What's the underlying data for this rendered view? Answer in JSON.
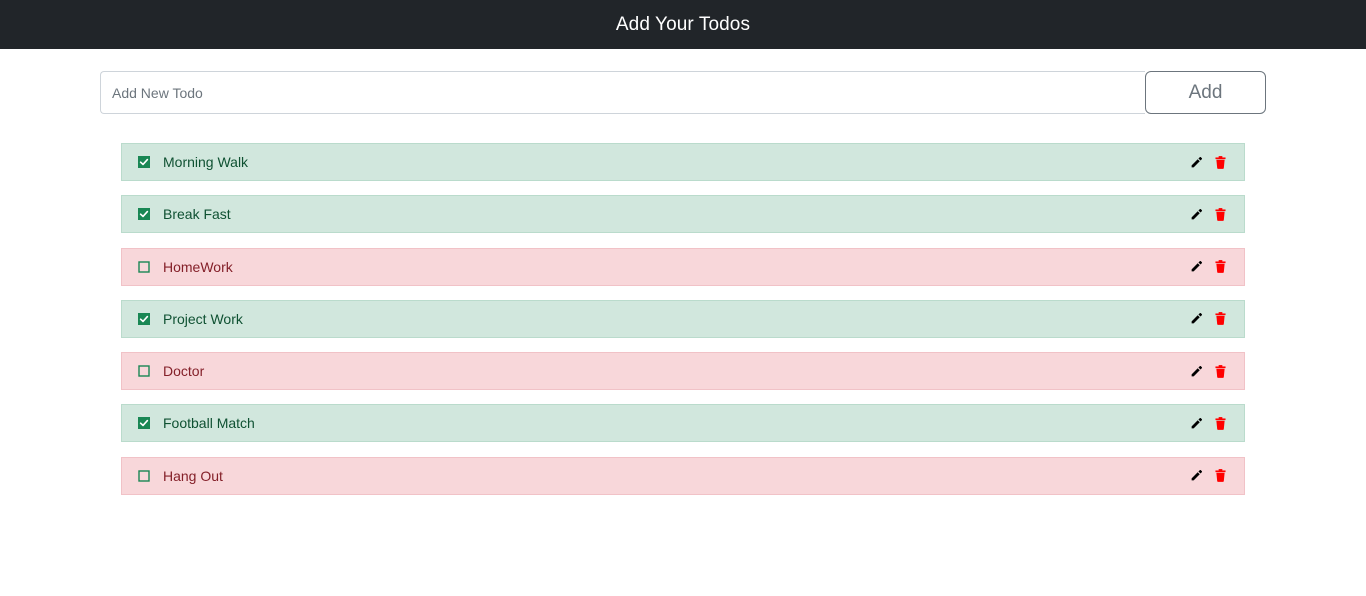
{
  "header": {
    "title": "Add Your Todos"
  },
  "add_form": {
    "input_placeholder": "Add New Todo",
    "input_value": "",
    "add_label": "Add"
  },
  "colors": {
    "done_bg": "#d1e7dd",
    "pending_bg": "#f8d7da",
    "checkbox_green": "#198754",
    "delete_red": "#ff0000"
  },
  "todos": [
    {
      "text": "Morning Walk",
      "completed": true,
      "icons": [
        "checked-checkbox-icon",
        "pencil-icon",
        "trash-icon"
      ]
    },
    {
      "text": "Break Fast",
      "completed": true,
      "icons": [
        "checked-checkbox-icon",
        "pencil-icon",
        "trash-icon"
      ]
    },
    {
      "text": "HomeWork",
      "completed": false,
      "icons": [
        "unchecked-checkbox-icon",
        "pencil-icon",
        "trash-icon"
      ]
    },
    {
      "text": "Project Work",
      "completed": true,
      "icons": [
        "checked-checkbox-icon",
        "pencil-icon",
        "trash-icon"
      ]
    },
    {
      "text": "Doctor",
      "completed": false,
      "icons": [
        "unchecked-checkbox-icon",
        "pencil-icon",
        "trash-icon"
      ]
    },
    {
      "text": "Football Match",
      "completed": true,
      "icons": [
        "checked-checkbox-icon",
        "pencil-icon",
        "trash-icon"
      ]
    },
    {
      "text": "Hang Out",
      "completed": false,
      "icons": [
        "unchecked-checkbox-icon",
        "pencil-icon",
        "trash-icon"
      ]
    }
  ]
}
